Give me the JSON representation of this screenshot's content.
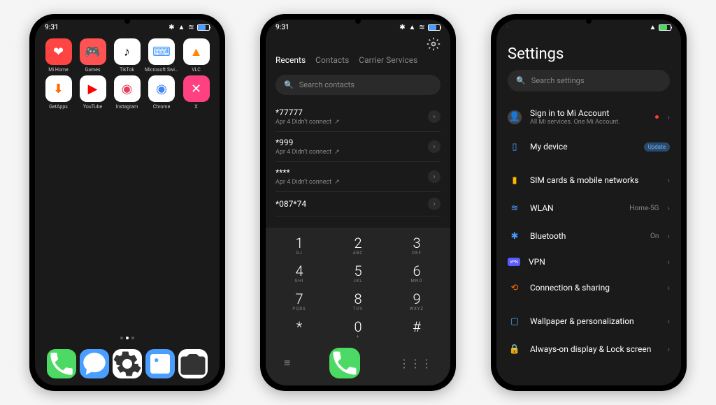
{
  "status": {
    "time": "9:31"
  },
  "home": {
    "apps": [
      {
        "label": "Mi Home",
        "bg": "#ff4444",
        "glyph": "❤",
        "gcolor": "#fff"
      },
      {
        "label": "Games",
        "bg": "#ff5252",
        "glyph": "🎮",
        "gcolor": "#fff"
      },
      {
        "label": "TikTok",
        "bg": "#fff",
        "glyph": "♪",
        "gcolor": "#000"
      },
      {
        "label": "Microsoft SwiftKey...",
        "bg": "#fff",
        "glyph": "⌨",
        "gcolor": "#4a9eff"
      },
      {
        "label": "VLC",
        "bg": "#fff",
        "glyph": "▲",
        "gcolor": "#ff8800"
      },
      {
        "label": "GetApps",
        "bg": "#fff",
        "glyph": "⬇",
        "gcolor": "#ff6b00"
      },
      {
        "label": "YouTube",
        "bg": "#fff",
        "glyph": "▶",
        "gcolor": "#ff0000"
      },
      {
        "label": "Instagram",
        "bg": "#fff",
        "glyph": "◉",
        "gcolor": "#e4405f"
      },
      {
        "label": "Chrome",
        "bg": "#fff",
        "glyph": "◉",
        "gcolor": "#4285f4"
      },
      {
        "label": "X",
        "bg": "#ff4081",
        "glyph": "✕",
        "gcolor": "#fff"
      }
    ],
    "dock": [
      {
        "name": "phone",
        "bg": "#4cd964"
      },
      {
        "name": "messages",
        "bg": "#4a9eff"
      },
      {
        "name": "settings",
        "bg": "#fff"
      },
      {
        "name": "gallery",
        "bg": "#4a9eff"
      },
      {
        "name": "camera",
        "bg": "#fff"
      }
    ]
  },
  "dialer": {
    "tabs": [
      "Recents",
      "Contacts",
      "Carrier Services"
    ],
    "active_tab": 0,
    "search_placeholder": "Search contacts",
    "calls": [
      {
        "number": "*77777",
        "meta": "Apr 4 Didn't connect"
      },
      {
        "number": "*999",
        "meta": "Apr 4 Didn't connect"
      },
      {
        "number": "****",
        "meta": "Apr 4 Didn't connect"
      },
      {
        "number": "*087*74",
        "meta": ""
      }
    ],
    "keys": [
      {
        "d": "1",
        "l": "GJ"
      },
      {
        "d": "2",
        "l": "ABC"
      },
      {
        "d": "3",
        "l": "DEF"
      },
      {
        "d": "4",
        "l": "GHI"
      },
      {
        "d": "5",
        "l": "JKL"
      },
      {
        "d": "6",
        "l": "MNO"
      },
      {
        "d": "7",
        "l": "PQRS"
      },
      {
        "d": "8",
        "l": "TUV"
      },
      {
        "d": "9",
        "l": "WXYZ"
      },
      {
        "d": "*",
        "l": ""
      },
      {
        "d": "0",
        "l": "+"
      },
      {
        "d": "#",
        "l": ""
      }
    ]
  },
  "settings": {
    "title": "Settings",
    "search_placeholder": "Search settings",
    "account": {
      "label": "Sign in to Mi Account",
      "sub": "All Mi services. One Mi Account."
    },
    "device": {
      "label": "My device",
      "badge": "Update"
    },
    "items": [
      {
        "icon": "▮",
        "color": "#ffb800",
        "label": "SIM cards & mobile networks",
        "value": ""
      },
      {
        "icon": "≋",
        "color": "#4a9eff",
        "label": "WLAN",
        "value": "Home-5G"
      },
      {
        "icon": "✱",
        "color": "#4a9eff",
        "label": "Bluetooth",
        "value": "On"
      },
      {
        "icon": "VPN",
        "color": "#5b5bff",
        "label": "VPN",
        "value": ""
      },
      {
        "icon": "⟲",
        "color": "#ff6b00",
        "label": "Connection & sharing",
        "value": ""
      }
    ],
    "items2": [
      {
        "icon": "▢",
        "color": "#4a9eff",
        "label": "Wallpaper & personalization",
        "value": ""
      },
      {
        "icon": "🔒",
        "color": "#ff3b30",
        "label": "Always-on display & Lock screen",
        "value": ""
      }
    ]
  }
}
